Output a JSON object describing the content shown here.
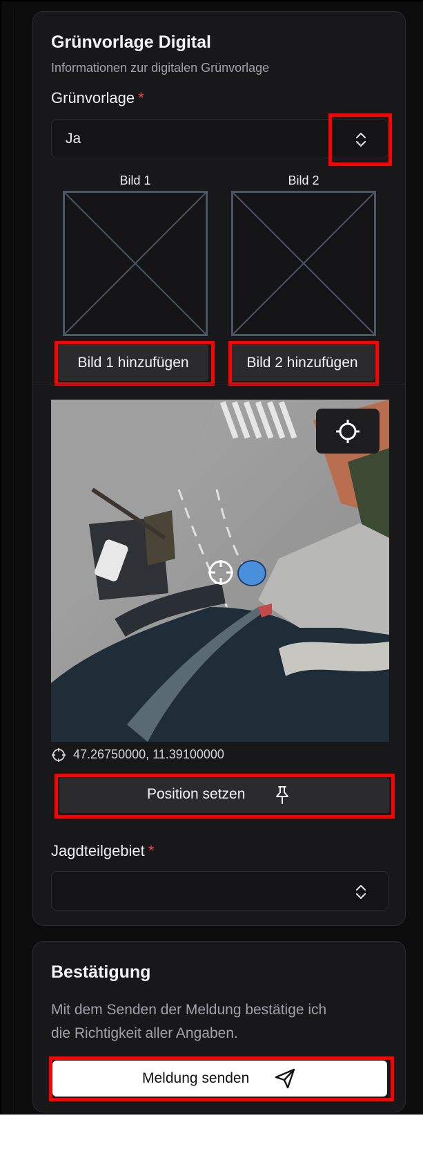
{
  "green_section": {
    "title": "Grünvorlage Digital",
    "subtitle": "Informationen zur digitalen Grünvorlage",
    "field_label": "Grünvorlage",
    "required_mark": "*",
    "select_value": "Ja",
    "image_slots": [
      {
        "label": "Bild 1",
        "button": "Bild 1 hinzufügen"
      },
      {
        "label": "Bild 2",
        "button": "Bild 2 hinzufügen"
      }
    ],
    "coordinates": "47.26750000, 11.39100000",
    "position_button": "Position setzen",
    "area_label": "Jagdteilgebiet",
    "area_value": ""
  },
  "confirm_section": {
    "title": "Bestätigung",
    "text_line1": "Mit dem Senden der Meldung bestätige ich",
    "text_line2": "die Richtigkeit aller Angaben.",
    "submit_button": "Meldung senden"
  },
  "colors": {
    "background": "#0c0c0d",
    "card": "#18181b",
    "required": "#ef4444",
    "highlight": "#ff0000",
    "marker": "#4a8fdb"
  }
}
